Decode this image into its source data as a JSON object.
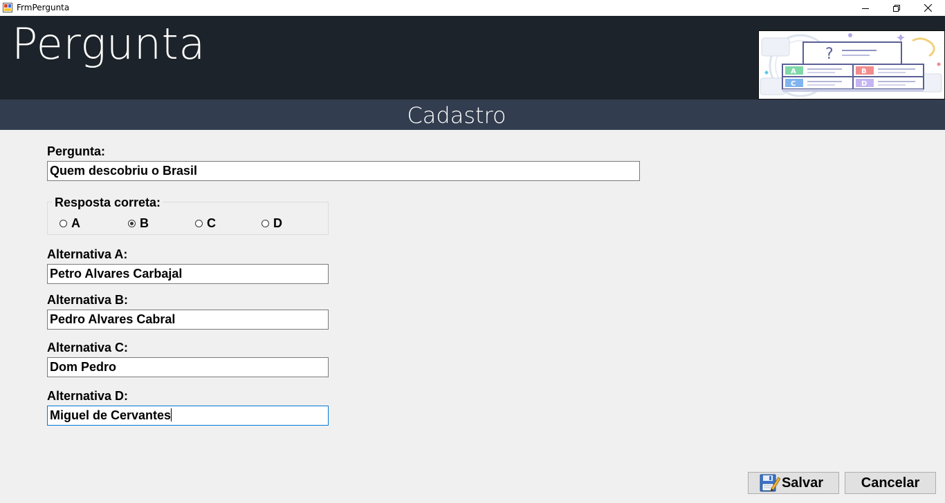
{
  "window": {
    "title": "FrmPergunta",
    "app_icon": "form-icon",
    "controls": [
      "minimize-icon",
      "restore-icon",
      "close-icon"
    ]
  },
  "header": {
    "title": "Pergunta",
    "image_icon": "quiz-illustration-icon",
    "image_options": [
      "A",
      "B",
      "C",
      "D"
    ],
    "image_question_mark": "?"
  },
  "subheader": {
    "title": "Cadastro"
  },
  "form": {
    "question_label": "Pergunta:",
    "question_value": "Quem descobriu o Brasil",
    "correct_answer": {
      "legend": "Resposta correta:",
      "options": [
        "A",
        "B",
        "C",
        "D"
      ],
      "selected": "B"
    },
    "alt_a_label": "Alternativa A:",
    "alt_a_value": "Petro Alvares Carbajal",
    "alt_b_label": "Alternativa B:",
    "alt_b_value": "Pedro Alvares Cabral",
    "alt_c_label": "Alternativa C:",
    "alt_c_value": "Dom Pedro",
    "alt_d_label": "Alternativa D:",
    "alt_d_value": "Miguel de Cervantes"
  },
  "buttons": {
    "save_label": "Salvar",
    "save_icon": "save-edit-icon",
    "cancel_label": "Cancelar"
  },
  "colors": {
    "header_bg": "#1c232a",
    "subheader_bg": "#323d4f",
    "form_bg": "#f0f0f0",
    "focus_border": "#0078d7"
  }
}
